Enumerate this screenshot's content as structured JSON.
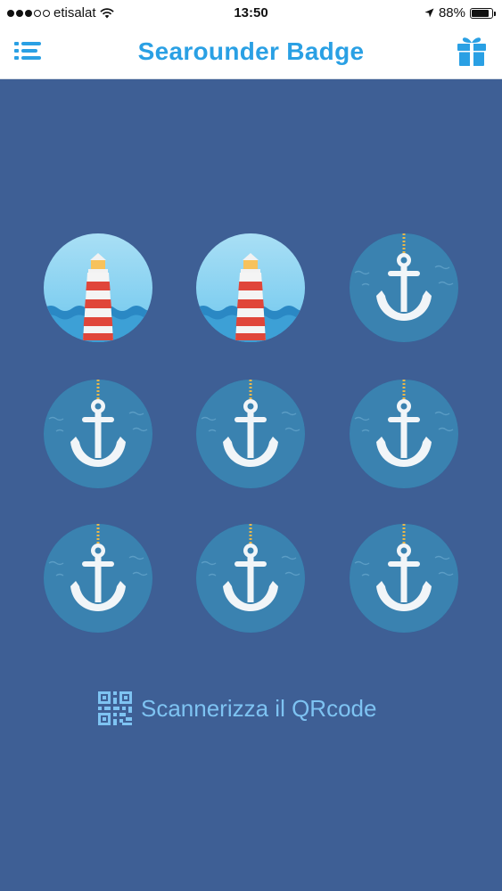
{
  "status_bar": {
    "carrier": "etisalat",
    "time": "13:50",
    "battery": "88%",
    "battery_level": 0.88,
    "signal_bars": 3,
    "signal_max": 5
  },
  "header": {
    "title": "Searounder Badge",
    "menu_icon": "menu-list-icon",
    "gift_icon": "gift-icon"
  },
  "badges": [
    {
      "type": "lighthouse"
    },
    {
      "type": "lighthouse"
    },
    {
      "type": "anchor"
    },
    {
      "type": "anchor"
    },
    {
      "type": "anchor"
    },
    {
      "type": "anchor"
    },
    {
      "type": "anchor"
    },
    {
      "type": "anchor"
    },
    {
      "type": "anchor"
    }
  ],
  "qr": {
    "label": "Scannerizza il QRcode",
    "icon": "qr-code-icon"
  },
  "colors": {
    "background": "#3e5f95",
    "accent": "#2aa0e4",
    "qr_text": "#7ec3f2"
  }
}
